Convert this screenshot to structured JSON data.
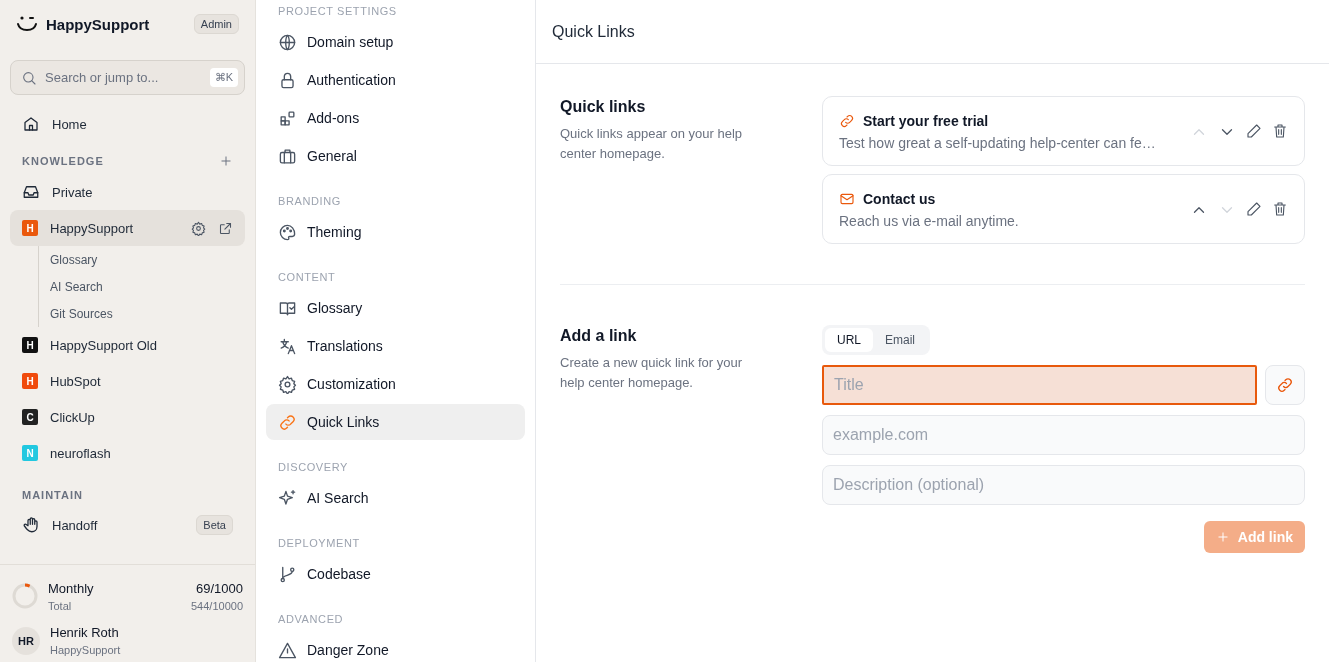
{
  "app": {
    "name": "HappySupport",
    "role_badge": "Admin"
  },
  "search": {
    "placeholder": "Search or jump to...",
    "shortcut": "⌘K"
  },
  "home": {
    "label": "Home"
  },
  "knowledge": {
    "title": "KNOWLEDGE",
    "items": [
      {
        "kind": "inbox",
        "label": "Private",
        "selected": false
      },
      {
        "kind": "project",
        "letter": "H",
        "color": "#ea580c",
        "label": "HappySupport",
        "selected": true,
        "children": [
          {
            "label": "Glossary"
          },
          {
            "label": "AI Search"
          },
          {
            "label": "Git Sources"
          }
        ]
      },
      {
        "kind": "project",
        "letter": "H",
        "color": "#111111",
        "label": "HappySupport Old",
        "selected": false
      },
      {
        "kind": "project",
        "letter": "H",
        "color": "#f04a0c",
        "label": "HubSpot",
        "selected": false
      },
      {
        "kind": "project",
        "letter": "C",
        "color": "#222222",
        "label": "ClickUp",
        "selected": false
      },
      {
        "kind": "project",
        "letter": "N",
        "color": "#22c8e0",
        "label": "neuroflash",
        "selected": false
      }
    ]
  },
  "maintain": {
    "title": "MAINTAIN",
    "items": [
      {
        "label": "Handoff",
        "badge": "Beta"
      }
    ]
  },
  "usage": {
    "label": "Monthly",
    "value": "69/1000",
    "sublabel": "Total",
    "subvalue": "544/10000",
    "level": 0.069
  },
  "user": {
    "initials": "HR",
    "name": "Henrik Roth",
    "org": "HappySupport"
  },
  "settings_nav": [
    {
      "title": "PROJECT SETTINGS",
      "items": [
        {
          "kind": "globe",
          "label": "Domain setup",
          "selected": false
        },
        {
          "kind": "lock",
          "label": "Authentication",
          "selected": false
        },
        {
          "kind": "blocks",
          "label": "Add-ons",
          "selected": false
        },
        {
          "kind": "briefcase",
          "label": "General",
          "selected": false
        }
      ]
    },
    {
      "title": "BRANDING",
      "items": [
        {
          "kind": "palette",
          "label": "Theming",
          "selected": false
        }
      ]
    },
    {
      "title": "CONTENT",
      "items": [
        {
          "kind": "book",
          "label": "Glossary",
          "selected": false
        },
        {
          "kind": "translate",
          "label": "Translations",
          "selected": false
        },
        {
          "kind": "gear",
          "label": "Customization",
          "selected": false
        },
        {
          "kind": "link",
          "label": "Quick Links",
          "selected": true
        }
      ]
    },
    {
      "title": "DISCOVERY",
      "items": [
        {
          "kind": "sparkle",
          "label": "AI Search",
          "selected": false
        }
      ]
    },
    {
      "title": "DEPLOYMENT",
      "items": [
        {
          "kind": "branch",
          "label": "Codebase",
          "selected": false
        }
      ]
    },
    {
      "title": "ADVANCED",
      "items": [
        {
          "kind": "warning",
          "label": "Danger Zone",
          "selected": false
        }
      ]
    }
  ],
  "page": {
    "title": "Quick Links"
  },
  "quick_links": {
    "title": "Quick links",
    "description": "Quick links appear on your help center homepage.",
    "links": [
      {
        "kind": "link",
        "title": "Start your free trial",
        "description": "Test how great a self-updating help-center can fe…",
        "up_disabled": true,
        "down_disabled": false
      },
      {
        "kind": "mail",
        "title": "Contact us",
        "description": "Reach us via e-mail anytime.",
        "up_disabled": false,
        "down_disabled": true
      }
    ]
  },
  "add_link": {
    "title": "Add a link",
    "description": "Create a new quick link for your help center homepage.",
    "tabs": [
      {
        "label": "URL",
        "selected": true
      },
      {
        "label": "Email",
        "selected": false
      }
    ],
    "fields": [
      {
        "placeholder": "Title",
        "focused": true
      },
      {
        "placeholder": "example.com",
        "focused": false
      },
      {
        "placeholder": "Description (optional)",
        "focused": false
      }
    ],
    "button": {
      "label": "Add link",
      "disabled": true
    }
  }
}
